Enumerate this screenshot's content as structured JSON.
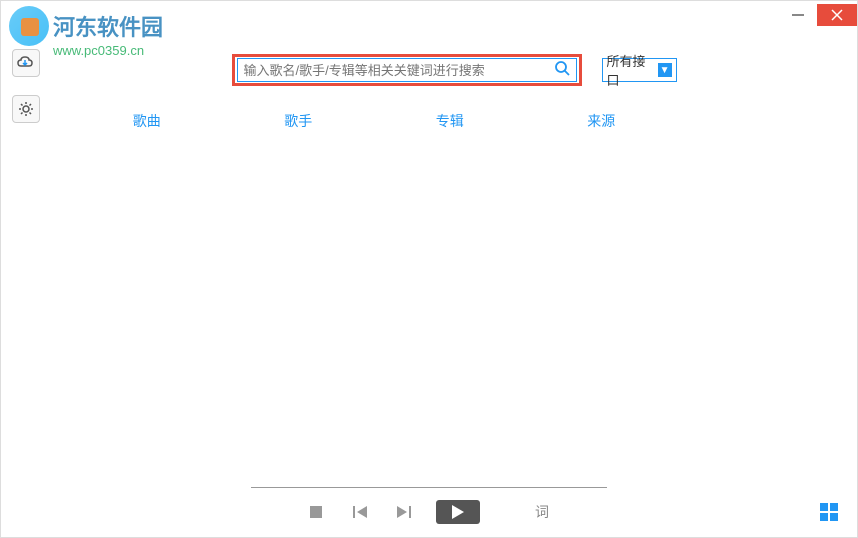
{
  "watermark": {
    "title": "河东软件园",
    "url": "www.pc0359.cn"
  },
  "search": {
    "placeholder": "输入歌名/歌手/专辑等相关关键词进行搜索"
  },
  "source_select": {
    "label": "所有接口"
  },
  "columns": {
    "song": "歌曲",
    "artist": "歌手",
    "album": "专辑",
    "source": "来源"
  },
  "player": {
    "lyrics_label": "词"
  }
}
